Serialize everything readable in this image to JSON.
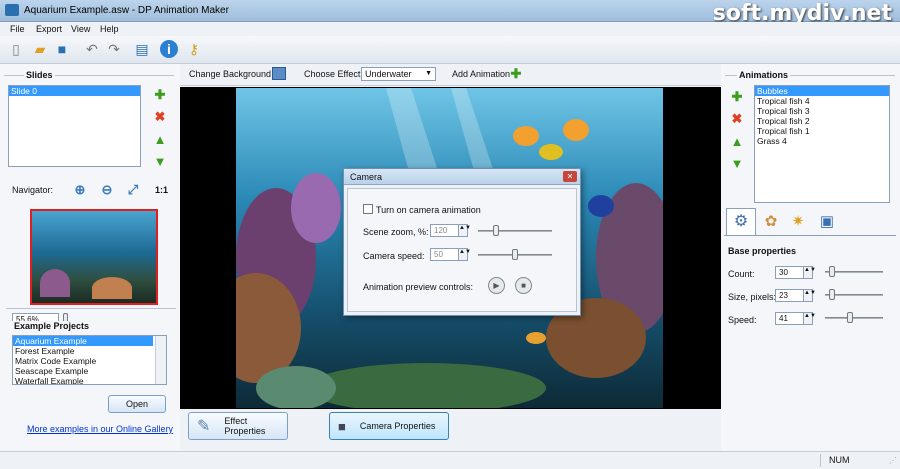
{
  "window": {
    "title": "Aquarium Example.asw - DP Animation Maker",
    "watermark": "soft.mydiv.net"
  },
  "menu": [
    "File",
    "Export",
    "View",
    "Help"
  ],
  "toolbar_icons": [
    "new-icon",
    "open-icon",
    "save-icon",
    "undo-icon",
    "redo-icon",
    "export-icon",
    "info-icon",
    "key-icon"
  ],
  "slides": {
    "heading": "Slides",
    "items": [
      "Slide 0"
    ]
  },
  "navigator": {
    "label": "Navigator:",
    "one_to_one": "1:1",
    "zoom": "55.6%"
  },
  "examples": {
    "heading": "Example Projects",
    "items": [
      "Aquarium Example",
      "Forest Example",
      "Matrix Code Example",
      "Seascape Example",
      "Waterfall Example"
    ],
    "open_label": "Open",
    "gallery_link": "More examples in our Online Gallery"
  },
  "top_controls": {
    "change_bg": "Change Background",
    "choose_effect": "Choose Effect:",
    "effect_value": "Underwater",
    "add_animation": "Add Animation"
  },
  "bottom_buttons": {
    "effect_props": "Effect Properties",
    "camera_props": "Camera Properties"
  },
  "camera_dialog": {
    "title": "Camera",
    "checkbox": "Turn on camera animation",
    "zoom_label": "Scene zoom, %:",
    "zoom_value": "120",
    "speed_label": "Camera speed:",
    "speed_value": "50",
    "preview_label": "Animation preview controls:"
  },
  "animations": {
    "heading": "Animations",
    "items": [
      "Bubbles",
      "Tropical fish 4",
      "Tropical fish 3",
      "Tropical fish 2",
      "Tropical fish 1",
      "Grass 4"
    ]
  },
  "base_props": {
    "heading": "Base properties",
    "count_label": "Count:",
    "count_value": "30",
    "size_label": "Size, pixels:",
    "size_value": "23",
    "speed_label": "Speed:",
    "speed_value": "41"
  },
  "status": {
    "num": "NUM"
  },
  "colors": {
    "accent": "#3399ff",
    "link": "#0033cc"
  }
}
